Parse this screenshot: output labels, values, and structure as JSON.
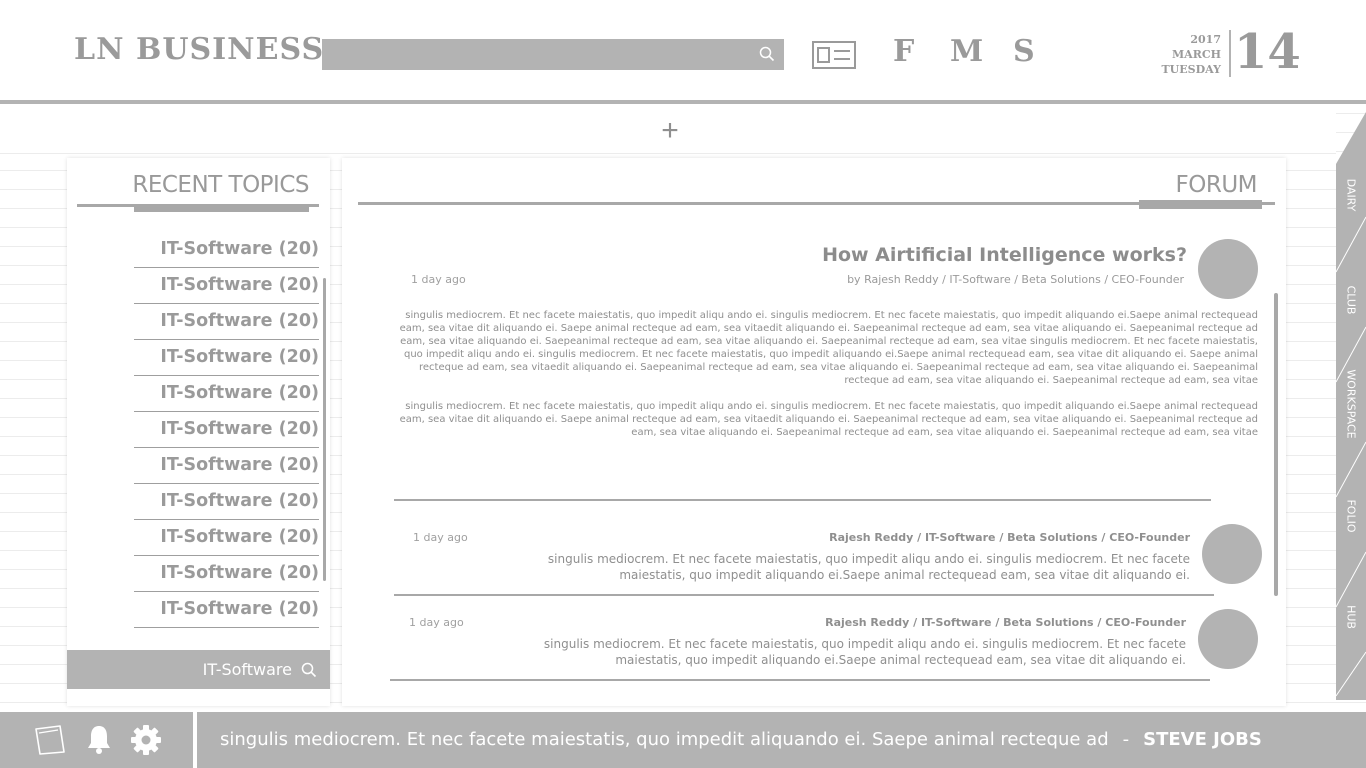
{
  "brand": "LN BUSINESS",
  "search": {
    "placeholder": ""
  },
  "nav": {
    "links": [
      "F",
      "M",
      "S"
    ]
  },
  "date": {
    "year": "2017",
    "month": "MARCH",
    "weekday": "TUESDAY",
    "day": "14"
  },
  "add_label": "+",
  "recent": {
    "title": "RECENT TOPICS",
    "items": [
      "IT-Software (20)",
      "IT-Software (20)",
      "IT-Software (20)",
      "IT-Software (20)",
      "IT-Software (20)",
      "IT-Software (20)",
      "IT-Software (20)",
      "IT-Software (20)",
      "IT-Software (20)",
      "IT-Software (20)",
      "IT-Software (20)"
    ],
    "search_value": "IT-Software"
  },
  "forum": {
    "title": "FORUM",
    "main_post": {
      "title": "How Airtificial Intelligence works?",
      "time": "1 day ago",
      "meta": "by Rajesh Reddy  /  IT-Software / Beta  Solutions / CEO-Founder",
      "paragraphs": [
        "singulis mediocrem. Et nec facete maiestatis, quo impedit aliqu ando ei. singulis mediocrem. Et nec facete maiestatis, quo impedit aliquando ei.Saepe animal rectequead eam, sea vitae dit aliquando ei. Saepe animal recteque ad eam, sea vitaedit aliquando ei. Saepeanimal recteque ad eam, sea vitae aliquando ei. Saepeanimal recteque ad eam, sea vitae aliquando ei. Saepeanimal recteque ad eam, sea vitae aliquando ei. Saepeanimal recteque ad eam, sea vitae singulis mediocrem. Et nec facete maiestatis, quo impedit aliqu ando ei. singulis mediocrem. Et nec facete maiestatis, quo impedit aliquando ei.Saepe animal rectequead eam, sea vitae dit aliquando ei. Saepe animal recteque ad eam, sea vitaedit aliquando ei. Saepeanimal recteque ad eam, sea vitae aliquando ei. Saepeanimal recteque ad eam, sea vitae aliquando ei. Saepeanimal recteque ad eam, sea vitae aliquando ei. Saepeanimal recteque ad eam, sea vitae",
        "singulis mediocrem. Et nec facete maiestatis, quo impedit aliqu ando ei. singulis mediocrem. Et nec facete maiestatis, quo impedit aliquando ei.Saepe animal rectequead eam, sea vitae dit aliquando ei. Saepe animal recteque ad eam, sea vitaedit aliquando ei. Saepeanimal recteque ad eam, sea vitae aliquando ei. Saepeanimal recteque ad eam, sea vitae aliquando ei. Saepeanimal recteque ad eam, sea vitae aliquando ei. Saepeanimal recteque ad eam, sea vitae"
      ]
    },
    "replies": [
      {
        "time": "1 day ago",
        "author": "Rajesh Reddy  /  IT-Software / Beta  Solutions / CEO-Founder",
        "text": "singulis mediocrem. Et nec facete maiestatis, quo impedit aliqu ando ei. singulis mediocrem. Et nec facete maiestatis, quo impedit aliquando ei.Saepe animal rectequead eam, sea vitae dit aliquando ei."
      },
      {
        "time": "1 day ago",
        "author": "Rajesh Reddy  /  IT-Software / Beta  Solutions / CEO-Founder",
        "text": "singulis mediocrem. Et nec facete maiestatis, quo impedit aliqu ando ei. singulis mediocrem. Et nec facete maiestatis, quo impedit aliquando ei.Saepe animal rectequead eam, sea vitae dit aliquando ei."
      }
    ]
  },
  "side_tabs": [
    "DAIRY",
    "CLUB",
    "WORKSPACE",
    "FOLIO",
    "HUB"
  ],
  "footer": {
    "icons": [
      "notes-icon",
      "bell-icon",
      "gear-icon"
    ],
    "quote": "singulis mediocrem. Et nec facete maiestatis, quo impedit aliquando ei. Saepe animal recteque ad",
    "separator": "-",
    "author": "STEVE JOBS"
  },
  "colors": {
    "panel_gray": "#b3b3b3",
    "text_gray": "#9a9a9a",
    "background": "#ffffff"
  }
}
